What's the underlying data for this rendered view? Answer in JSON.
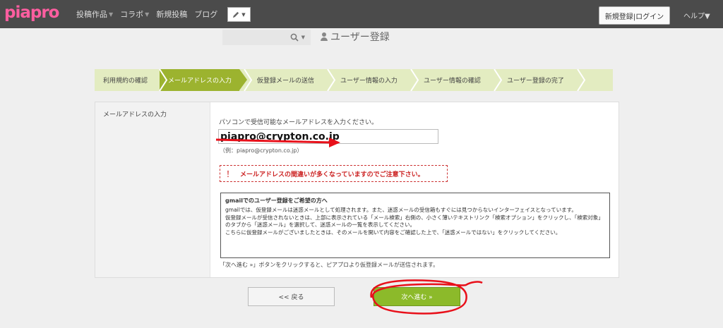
{
  "header": {
    "logo": "piapro",
    "nav": [
      {
        "label": "投稿作品",
        "caret": "▼"
      },
      {
        "label": "コラボ",
        "caret": "▼"
      },
      {
        "label": "新規投稿",
        "caret": ""
      },
      {
        "label": "ブログ",
        "caret": ""
      }
    ],
    "pen_icon": "pencil-icon",
    "register_login": "新規登録|ログイン",
    "help": "ヘルプ▼"
  },
  "search": {
    "icon": "search-icon",
    "caret": "▼"
  },
  "page_title": "ユーザー登録",
  "steps": [
    {
      "label": "利用規約の確認",
      "active": false
    },
    {
      "label": "メールアドレスの入力",
      "active": true
    },
    {
      "label": "仮登録メールの送信",
      "active": false
    },
    {
      "label": "ユーザー情報の入力",
      "active": false
    },
    {
      "label": "ユーザー情報の確認",
      "active": false
    },
    {
      "label": "ユーザー登録の完了",
      "active": false
    }
  ],
  "form": {
    "label": "メールアドレスの入力",
    "instruction": "パソコンで受信可能なメールアドレスを入力ください。",
    "email_value": "piapro@crypton.co.jp",
    "example": "（例：piapro@crypton.co.jp）",
    "warning": "メールアドレスの間違いが多くなっていますのでご注意下さい。",
    "warning_mark": "！",
    "notice_title": "gmailでのユーザー登録をご希望の方へ",
    "notice_lines": [
      "gmailでは、仮登録メールは迷惑メールとして処理されます。また、迷惑メールの受信箱もすぐには見つからないインターフェイスとなっています。",
      "仮登録メールが受信されないときは、上部に表示されている「メール検索」右側の、小さく薄いテキストリンク「検索オプション」をクリックし、「検索対象」のタブから「迷惑メール」を選択して、迷惑メールの一覧を表示してください。",
      "こちらに仮登録メールがございましたときは、そのメールを開いて内容をご確認した上で、「迷惑メールではない」をクリックしてください。"
    ],
    "after_note": "「次へ進む »」ボタンをクリックすると、ピアプロより仮登録メールが送信されます。"
  },
  "buttons": {
    "back": "<< 戻る",
    "next": "次へ進む »"
  },
  "colors": {
    "accent": "#9cb32f",
    "next": "#8cba2a",
    "annotation": "#e8101a",
    "logo": "#ff5ea0"
  }
}
